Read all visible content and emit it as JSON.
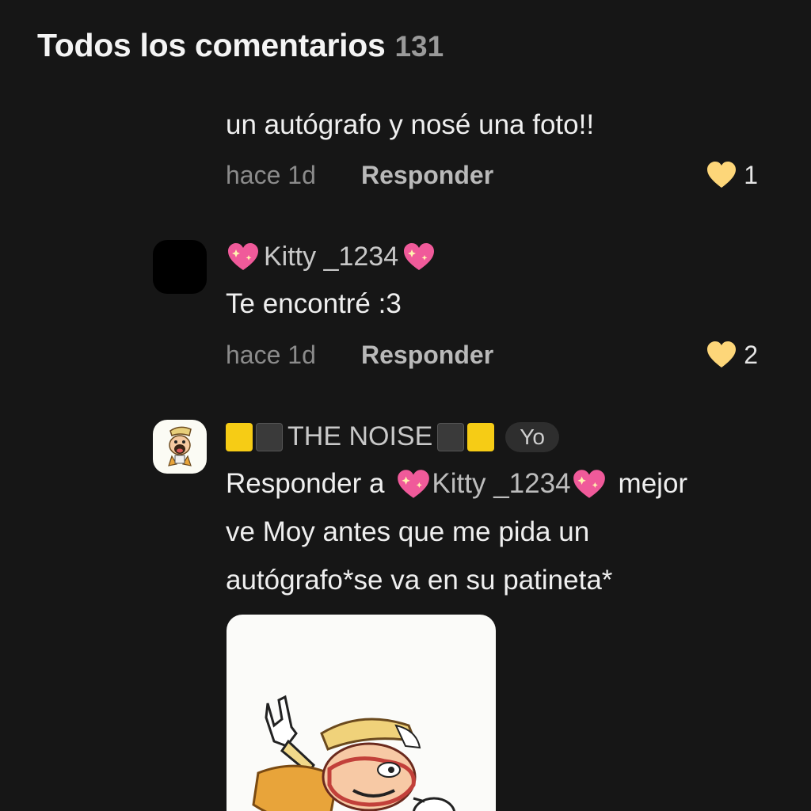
{
  "header": {
    "title": "Todos los comentarios",
    "count": "131"
  },
  "comments": [
    {
      "text": "un autógrafo y nosé una foto!!",
      "time": "hace 1d",
      "reply_label": "Responder",
      "likes": "1"
    },
    {
      "username": "Kitty _1234",
      "text": "Te encontré :3",
      "time": "hace 1d",
      "reply_label": "Responder",
      "likes": "2"
    },
    {
      "username": "THE NOISE",
      "badge": "Yo",
      "reply_prefix": "Responder a",
      "mention": "Kitty _1234",
      "line1_suffix": "mejor",
      "line2": "ve Moy antes que me pida un",
      "line3": "autógrafo*se va en su patineta*"
    }
  ],
  "icons": {
    "like": "heart-icon",
    "sparkle_heart": "sparkling-heart-emoji",
    "yellow_square": "yellow-square-emoji",
    "black_square": "black-square-emoji"
  },
  "colors": {
    "background": "#161616",
    "like_heart": "#fdd679",
    "sparkle_heart": "#f05a9a"
  }
}
